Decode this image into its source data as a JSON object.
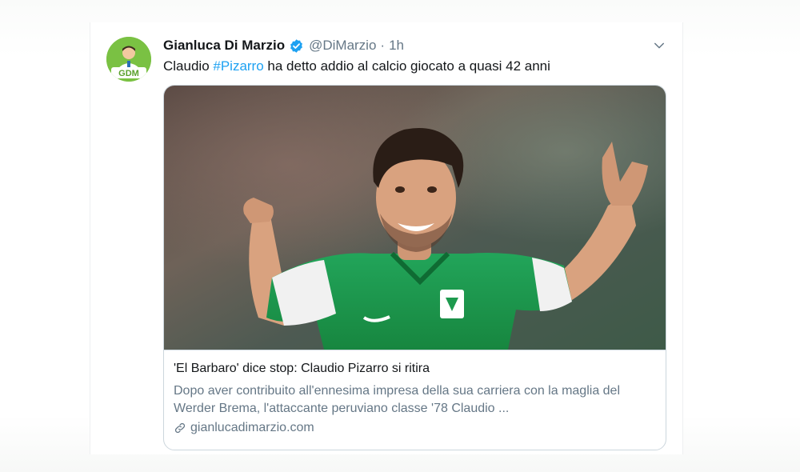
{
  "tweet": {
    "display_name": "Gianluca Di Marzio",
    "handle": "@DiMarzio",
    "separator": "·",
    "time": "1h",
    "text_before": "Claudio ",
    "hashtag": "#Pizarro",
    "text_after": " ha detto addio al calcio giocato a quasi 42 anni",
    "avatar_label": "GDM",
    "icons": [
      "verified-badge-icon",
      "chevron-down-icon",
      "link-icon"
    ],
    "colors": {
      "link": "#1da1f2",
      "avatar_bg": "#7ac143",
      "jersey": "#1d9a4e"
    }
  },
  "card": {
    "title": "'El Barbaro' dice stop: Claudio Pizarro si ritira",
    "description": "Dopo aver contribuito all'ennesima impresa della sua carriera con la maglia del Werder Brema, l'attaccante peruviano classe '78 Claudio ...",
    "domain": "gianlucadimarzio.com"
  }
}
